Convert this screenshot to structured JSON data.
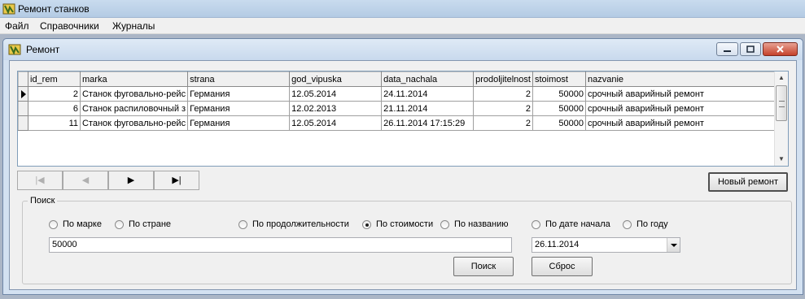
{
  "app": {
    "title": "Ремонт станков"
  },
  "menu": [
    "Файл",
    "Справочники",
    "Журналы"
  ],
  "child": {
    "title": "Ремонт"
  },
  "grid": {
    "columns": [
      "id_rem",
      "marka",
      "strana",
      "god_vipuska",
      "data_nachala",
      "prodoljitelnost",
      "stoimost",
      "nazvanie"
    ],
    "rows": [
      [
        "2",
        "Станок фуговально-рейс",
        "Германия",
        "12.05.2014",
        "24.11.2014",
        "2",
        "50000",
        "срочный аварийный ремонт"
      ],
      [
        "6",
        "Станок распиловочный з",
        "Германия",
        "12.02.2013",
        "21.11.2014",
        "2",
        "50000",
        "срочный аварийный ремонт"
      ],
      [
        "11",
        "Станок фуговально-рейс",
        "Германия",
        "12.05.2014",
        "26.11.2014 17:15:29",
        "2",
        "50000",
        "срочный аварийный ремонт"
      ]
    ],
    "current_row": 0
  },
  "navigator": {
    "first": "|◀",
    "prior": "◀",
    "next": "▶",
    "last": "▶|"
  },
  "buttons": {
    "new_repair": "Новый ремонт",
    "search": "Поиск",
    "reset": "Сброс"
  },
  "search": {
    "legend": "Поиск",
    "options": [
      {
        "label": "По марке",
        "checked": false
      },
      {
        "label": "По стране",
        "checked": false
      },
      {
        "label": "По продолжительности",
        "checked": false
      },
      {
        "label": "По стоимости",
        "checked": true
      },
      {
        "label": "По названию",
        "checked": false
      },
      {
        "label": "По дате начала",
        "checked": false
      },
      {
        "label": "По году",
        "checked": false
      }
    ],
    "text_value": "50000",
    "date_value": "26.11.2014"
  }
}
